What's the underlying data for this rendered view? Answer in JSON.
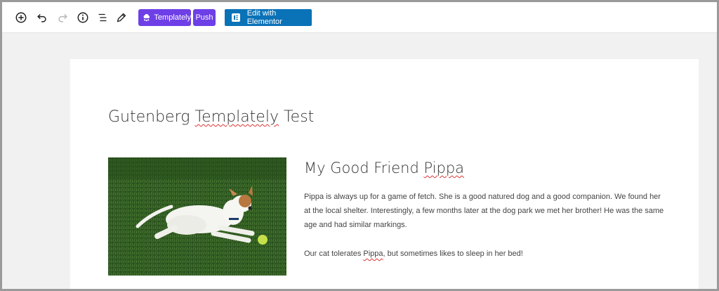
{
  "toolbar": {
    "templately_label": "Templately",
    "push_label": "Push",
    "elementor_label": "Edit with Elementor",
    "icons": [
      "add-block-icon",
      "undo-icon",
      "redo-icon",
      "info-icon",
      "outline-icon",
      "edit-pencil-icon"
    ],
    "colors": {
      "templately": "#6e3fe6",
      "elementor": "#0a72b7"
    }
  },
  "post": {
    "title_pre": "Gutenberg ",
    "title_misspelled": "Templately",
    "title_post": " Test",
    "heading_pre": "My Good Friend ",
    "heading_misspelled": "Pippa",
    "paragraph1": "Pippa is always up for a game of fetch.  She is a good natured dog and a good companion.  We found her at the local shelter.  Interestingly, a few months later at the dog park we met her brother!  He was the same age and had similar markings.",
    "paragraph2_pre": "Our cat tolerates ",
    "paragraph2_misspelled": "Pippa",
    "paragraph2_post": ", but sometimes likes to sleep in her bed!"
  }
}
